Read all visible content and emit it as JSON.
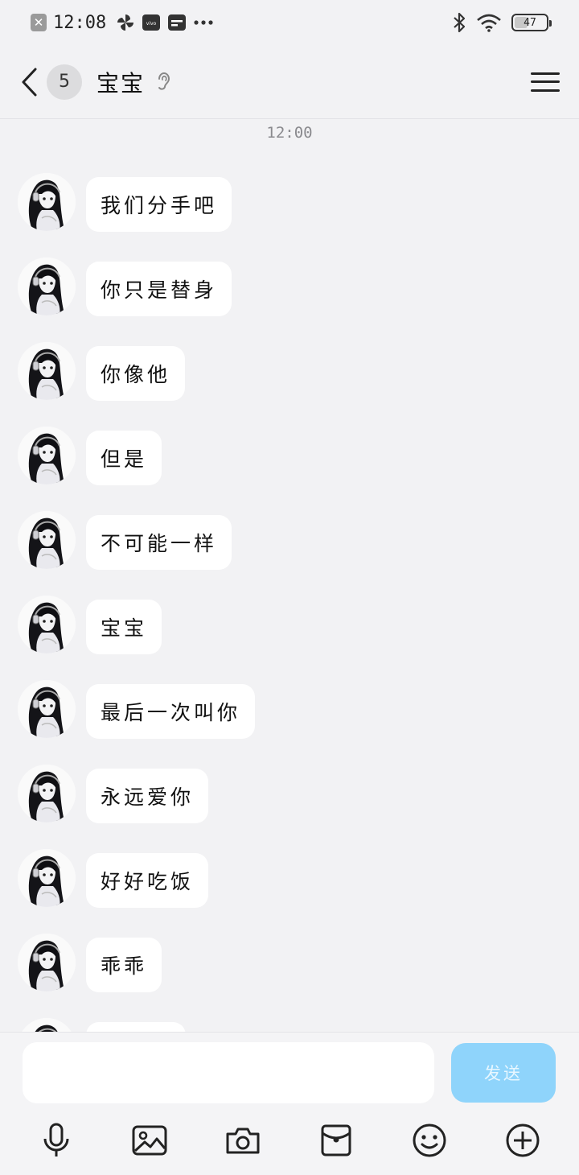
{
  "status_bar": {
    "time": "12:08",
    "battery_level": "47",
    "battery_fraction": 0.47,
    "icons": [
      "close-notification-icon",
      "pinwheel-icon",
      "vivo-icon",
      "wallet-icon",
      "more-dots-icon",
      "bluetooth-icon",
      "wifi-icon",
      "battery-icon"
    ]
  },
  "header": {
    "unread_count": "5",
    "title": "宝宝"
  },
  "timestamp": "12:00",
  "messages": [
    {
      "text": "我们分手吧"
    },
    {
      "text": "你只是替身"
    },
    {
      "text": "你像他"
    },
    {
      "text": "但是"
    },
    {
      "text": "不可能一样"
    },
    {
      "text": "宝宝"
    },
    {
      "text": "最后一次叫你"
    },
    {
      "text": "永远爱你"
    },
    {
      "text": "好好吃饭"
    },
    {
      "text": "乖乖"
    },
    {
      "text": ""
    }
  ],
  "composer": {
    "input_value": "",
    "send_label": "发送"
  },
  "toolbar": {
    "icons": [
      "microphone-icon",
      "image-icon",
      "camera-icon",
      "red-packet-icon",
      "emoji-icon",
      "plus-icon"
    ]
  },
  "colors": {
    "background": "#f2f2f4",
    "bubble": "#ffffff",
    "send_button": "#8fd4fb"
  }
}
